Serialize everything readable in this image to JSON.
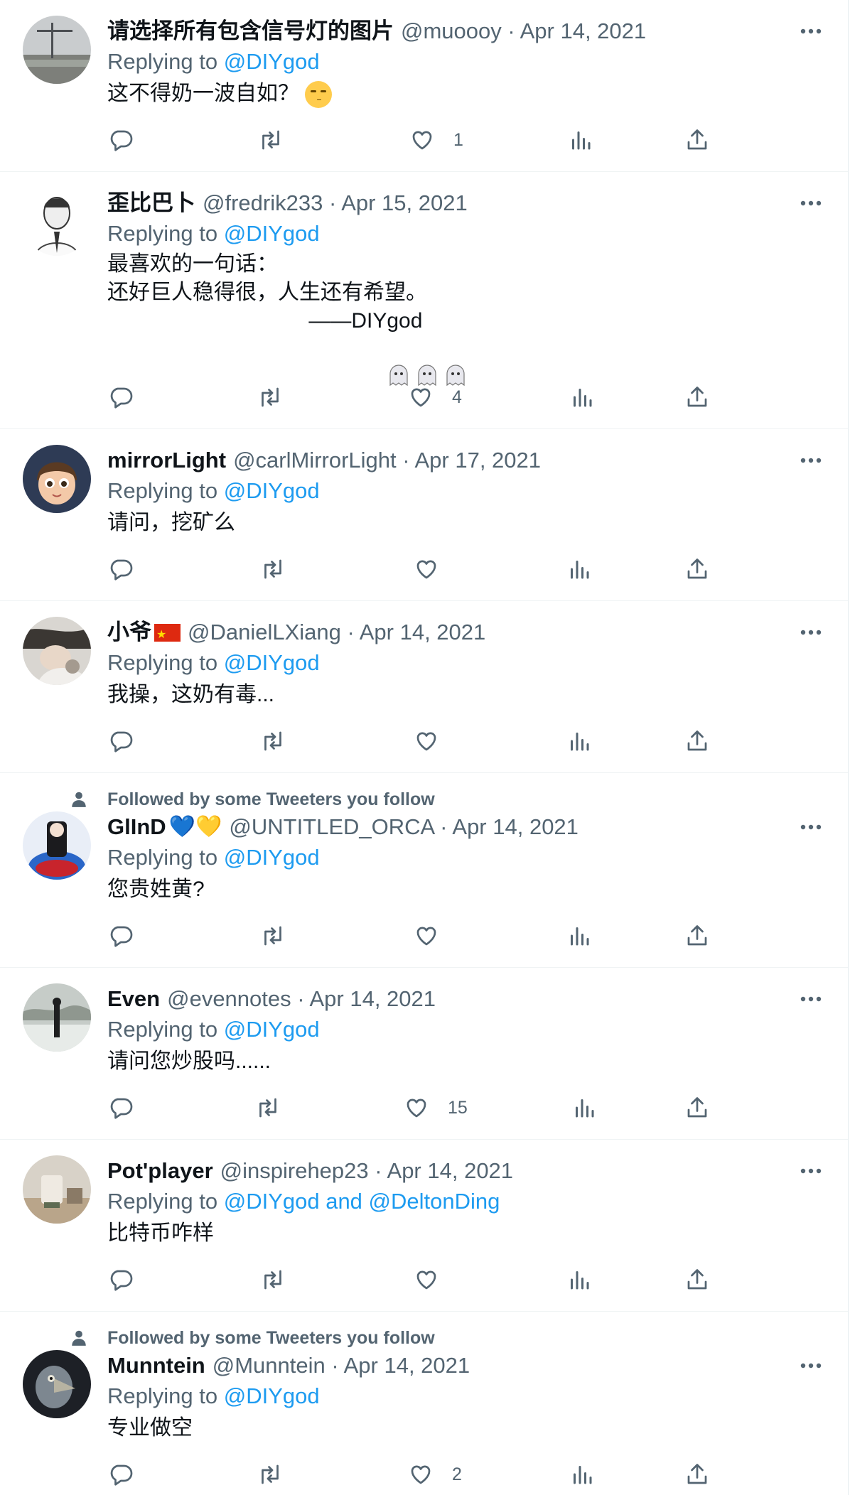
{
  "replying_label": "Replying to",
  "social_context_label": "Followed by some Tweeters you follow",
  "colors": {
    "link": "#1d9bf0",
    "secondary_text": "#536471",
    "primary_text": "#0f1419",
    "divider": "#eff3f4"
  },
  "icons": {
    "more": "more-horizontal-icon",
    "reply": "reply-icon",
    "retweet": "retweet-icon",
    "like": "heart-icon",
    "views": "views-chart-icon",
    "share": "share-icon"
  },
  "tweets": [
    {
      "name": "请选择所有包含信号灯的图片",
      "handle": "@muoooy",
      "sep": "·",
      "date": "Apr 14, 2021",
      "reply_to": "@DIYgod",
      "text": "这不得奶一波自如？",
      "emoji": "smirking-face-emoji",
      "likes": "1"
    },
    {
      "name": "歪比巴卜",
      "handle": "@fredrik233",
      "sep": "·",
      "date": "Apr 15, 2021",
      "reply_to": "@DIYgod",
      "text_lines": [
        "最喜欢的一句话：",
        "还好巨人稳得很，人生还有希望。",
        "                ——DIYgod"
      ],
      "emoji": "ghost-emoji ×3",
      "likes": "4"
    },
    {
      "name": "mirrorLight",
      "handle": "@carlMirrorLight",
      "sep": "·",
      "date": "Apr 17, 2021",
      "reply_to": "@DIYgod",
      "text": "请问，挖矿么",
      "likes": ""
    },
    {
      "name": "小爷",
      "flag": "china-flag-emoji",
      "handle": "@DanielLXiang",
      "sep": "·",
      "date": "Apr 14, 2021",
      "reply_to": "@DIYgod",
      "text": "我操，这奶有毒...",
      "likes": ""
    },
    {
      "name": "GlInD",
      "name_emoji": "💙💛",
      "handle": "@UNTITLED_ORCA",
      "sep": "·",
      "date": "Apr 14, 2021",
      "reply_to": "@DIYgod",
      "text": "您贵姓黄?",
      "likes": "",
      "social": true
    },
    {
      "name": "Even",
      "handle": "@evennotes",
      "sep": "·",
      "date": "Apr 14, 2021",
      "reply_to": "@DIYgod",
      "text": "请问您炒股吗......",
      "likes": "15"
    },
    {
      "name": "Pot'player",
      "handle": "@inspirehep23",
      "sep": "·",
      "date": "Apr 14, 2021",
      "reply_to": "@DIYgod and @DeltonDing",
      "text": "比特币咋样",
      "likes": ""
    },
    {
      "name": "Munntein",
      "handle": "@Munntein",
      "sep": "·",
      "date": "Apr 14, 2021",
      "reply_to": "@DIYgod",
      "text": "专业做空",
      "likes": "2",
      "social": true
    }
  ]
}
